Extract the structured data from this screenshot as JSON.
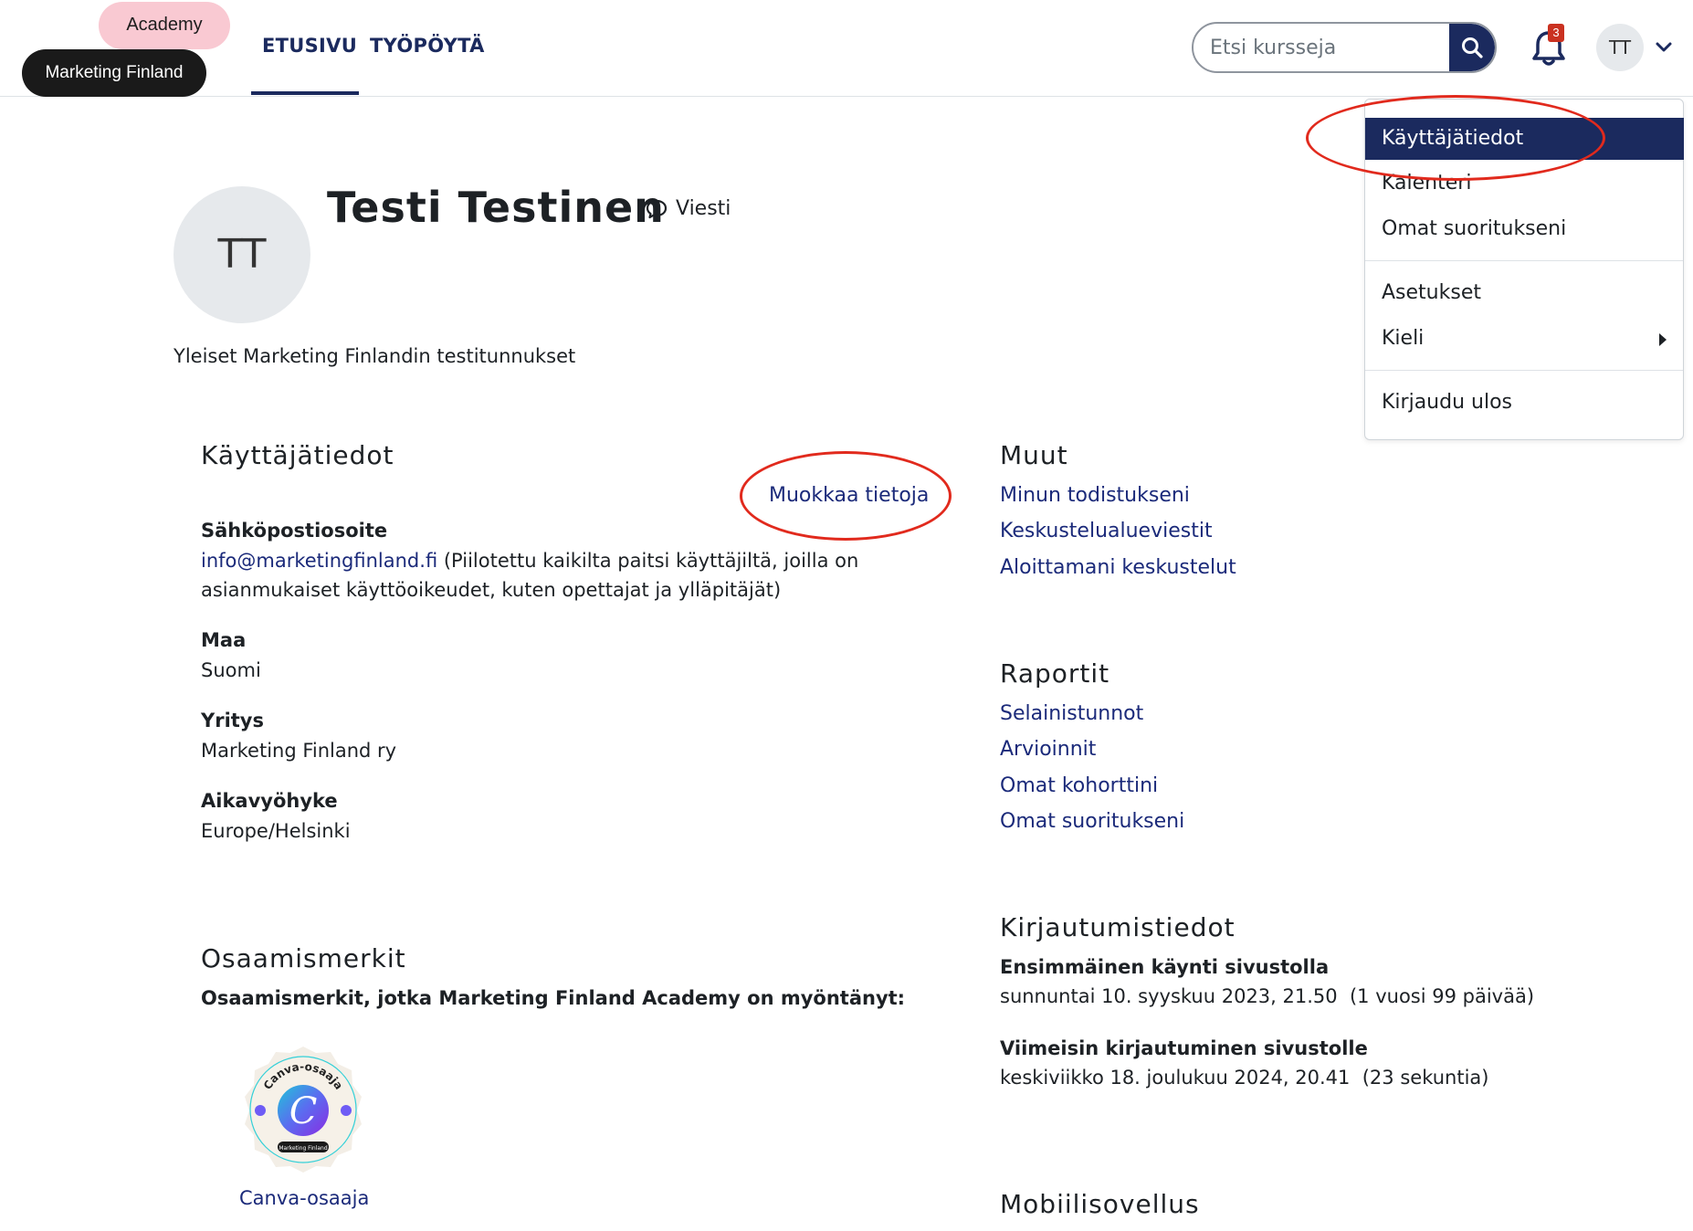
{
  "logo": {
    "academy": "Academy",
    "brand": "Marketing Finland"
  },
  "nav": {
    "home": "ETUSIVU",
    "dashboard": "TYÖPÖYTÄ"
  },
  "search": {
    "placeholder": "Etsi kursseja"
  },
  "notifications": {
    "count": "3"
  },
  "user": {
    "initials": "TT"
  },
  "dropdown": {
    "items": [
      "Käyttäjätiedot",
      "Kalenteri",
      "Omat suoritukseni",
      "Asetukset",
      "Kieli",
      "Kirjaudu ulos"
    ]
  },
  "profile": {
    "name": "Testi Testinen",
    "message": "Viesti",
    "description": "Yleiset Marketing Finlandin testitunnukset"
  },
  "user_details": {
    "title": "Käyttäjätiedot",
    "edit": "Muokkaa tietoja",
    "email_label": "Sähköpostiosoite",
    "email": "info@marketingfinland.fi",
    "email_note_1": " (Piilotettu kaikilta paitsi käyttäjiltä, joilla on",
    "email_note_2": "asianmukaiset käyttöoikeudet, kuten opettajat ja ylläpitäjät)",
    "country_label": "Maa",
    "country": "Suomi",
    "company_label": "Yritys",
    "company": "Marketing Finland ry",
    "timezone_label": "Aikavyöhyke",
    "timezone": "Europe/Helsinki"
  },
  "badges": {
    "title": "Osaamismerkit",
    "subtitle": "Osaamismerkit, jotka Marketing Finland Academy on myöntänyt:",
    "badge_ring_text": "Canva-osaaja",
    "badge_footer": "Marketing Finland",
    "badge_letter": "C",
    "badge_name": "Canva-osaaja"
  },
  "misc": {
    "title": "Muut",
    "links": [
      "Minun todistukseni",
      "Keskustelualueviestit",
      "Aloittamani keskustelut"
    ]
  },
  "reports": {
    "title": "Raportit",
    "links": [
      "Selainistunnot",
      "Arvioinnit",
      "Omat kohorttini",
      "Omat suoritukseni"
    ]
  },
  "login": {
    "title": "Kirjautumistiedot",
    "first_label": "Ensimmäinen käynti sivustolla",
    "first_value": "sunnuntai 10. syyskuu 2023, 21.50  (1 vuosi 99 päivää)",
    "last_label": "Viimeisin kirjautuminen sivustolle",
    "last_value": "keskiviikko 18. joulukuu 2024, 20.41  (23 sekuntia)"
  },
  "mobile": {
    "title": "Mobiilisovellus"
  },
  "colors": {
    "brand_navy": "#1b2a5e",
    "annotation_red": "#e12a1d",
    "badge_pink": "#f9c9d2"
  }
}
